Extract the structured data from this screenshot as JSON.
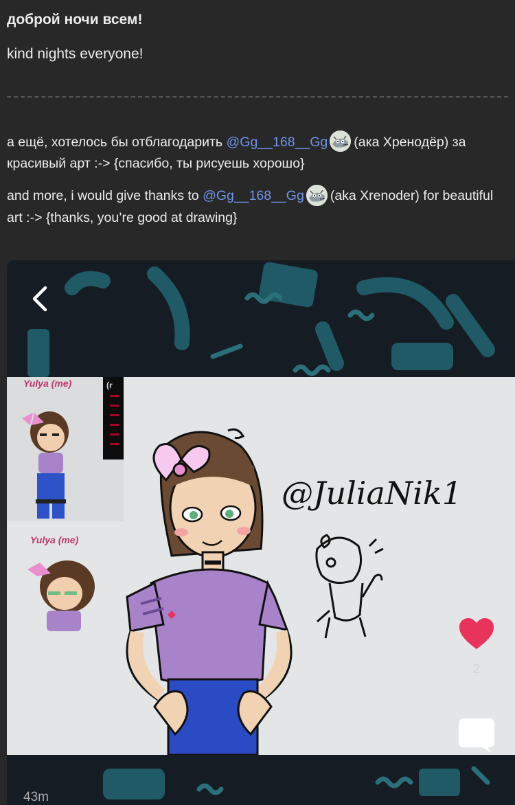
{
  "post": {
    "greeting_ru": "доброй ночи всем!",
    "greeting_en": "kind nights everyone!",
    "thanks_ru": {
      "before": "а ещё, хотелось бы отблагодарить ",
      "mention": "@Gg__168__Gg",
      "after": "(ака Хренодёр) за красивый арт :-> {спасибо, ты рисуешь хорошо}"
    },
    "thanks_en": {
      "before": "and more, i would give thanks to ",
      "mention": "@Gg__168__Gg",
      "after": "(aka Xrenoder) for beautiful art :-> {thanks, you’re good at drawing}"
    }
  },
  "viewer": {
    "back_icon": "chevron-left-icon",
    "art": {
      "label_top": "Yulya (me)",
      "label_bottom": "Yulya (me)",
      "label_ro": "(r",
      "signature": "@JuliaNik1"
    },
    "likes": "2",
    "like_icon": "heart-icon",
    "comment_icon": "speech-bubble-icon",
    "timestamp": "43m"
  },
  "colors": {
    "background": "#282828",
    "mention": "#6f93e8",
    "heart": "#e8335c",
    "viewer_bg": "#161c24",
    "shapes": "#1f5a66"
  }
}
